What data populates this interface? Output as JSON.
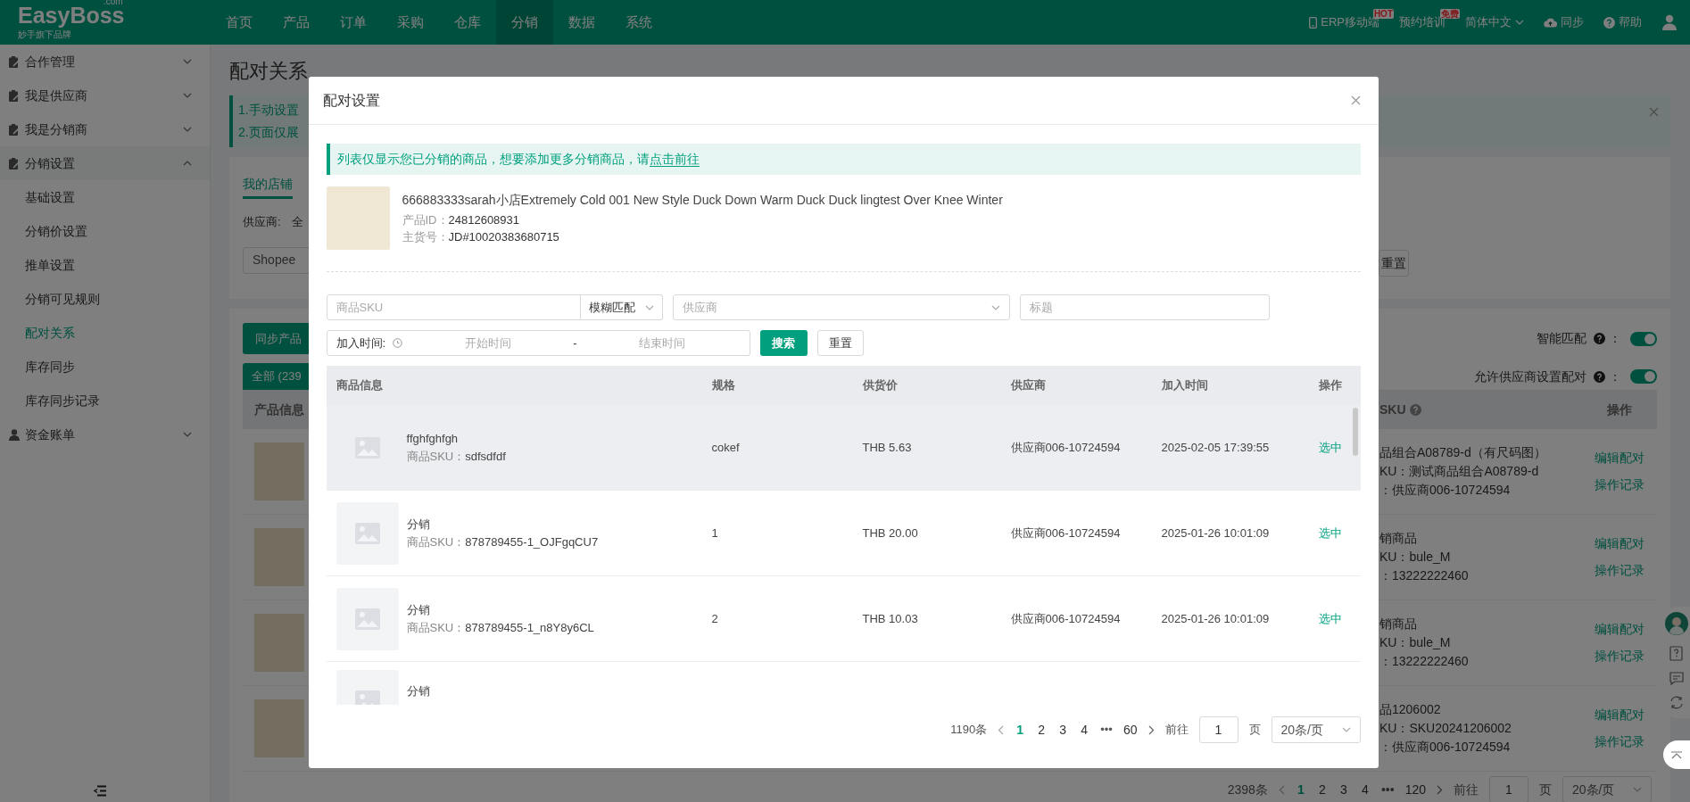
{
  "top_nav": {
    "logo": "EasyBoss",
    "logo_suffix": ".com",
    "logo_tagline": "妙手旗下品牌",
    "menu": [
      {
        "label": "首页",
        "selected": false
      },
      {
        "label": "产品",
        "selected": false
      },
      {
        "label": "订单",
        "selected": false
      },
      {
        "label": "采购",
        "selected": false
      },
      {
        "label": "仓库",
        "selected": false
      },
      {
        "label": "分销",
        "selected": true
      },
      {
        "label": "数据",
        "selected": false
      },
      {
        "label": "系统",
        "selected": false
      }
    ],
    "tools": [
      {
        "kind": "link",
        "label": "ERP移动端",
        "badge": "HOT"
      },
      {
        "kind": "link",
        "label": "预约培训",
        "badge": "免费"
      },
      {
        "kind": "dropdown",
        "label": "简体中文"
      },
      {
        "kind": "link",
        "label": "同步"
      },
      {
        "kind": "link",
        "label": "帮助"
      }
    ]
  },
  "sidebar": {
    "groups": [
      {
        "label": "合作管理",
        "expanded": false
      },
      {
        "label": "我是供应商",
        "expanded": false
      },
      {
        "label": "我是分销商",
        "expanded": false
      },
      {
        "label": "分销设置",
        "expanded": true,
        "children": [
          {
            "label": "基础设置",
            "selected": false
          },
          {
            "label": "分销价设置",
            "selected": false
          },
          {
            "label": "推单设置",
            "selected": false
          },
          {
            "label": "分销可见规则",
            "selected": false
          },
          {
            "label": "配对关系",
            "selected": true
          },
          {
            "label": "库存同步",
            "selected": false
          },
          {
            "label": "库存同步记录",
            "selected": false
          }
        ]
      },
      {
        "label": "资金账单",
        "expanded": false
      }
    ]
  },
  "page": {
    "title": "配对关系",
    "notice_lines": [
      "1.手动设置",
      "2.页面仅展"
    ],
    "store_tab": {
      "label": "我的店铺",
      "selected": true
    },
    "supplier_filter": {
      "label": "供应商:",
      "value": "全"
    },
    "platform_select": "Shopee",
    "reset_button": "重置",
    "sync_button": "同步产品",
    "switches": [
      {
        "label": "智能匹配",
        "suffix": "：",
        "on": true
      },
      {
        "label": "允许供应商设置配对",
        "suffix": "：",
        "on": true
      }
    ],
    "all_tab": {
      "label": "全部 (239",
      "selected": true
    },
    "columns": [
      "产品信息",
      "SKU",
      "操作"
    ],
    "rows": [
      {
        "lines": [
          "品组合A08789-d（有尺码图）",
          "KU：测试商品组合A08789-d",
          "：供应商006-10724594"
        ],
        "actions": [
          "编辑配对",
          "操作记录"
        ]
      },
      {
        "lines": [
          "销商品",
          "KU：bule_M",
          "：13222222460"
        ],
        "actions": [
          "编辑配对",
          "操作记录"
        ]
      },
      {
        "lines": [
          "销商品",
          "KU：bule_M",
          "：13222222460"
        ],
        "actions": [
          "编辑配对",
          "操作记录"
        ]
      },
      {
        "lines": [
          "品1206002",
          "KU：SKU20241206002",
          "：供应商006-10724594"
        ],
        "actions": [
          "编辑配对",
          "操作记录"
        ]
      }
    ],
    "pagination": {
      "total": "2398条",
      "pages": [
        {
          "label": "1",
          "selected": true
        },
        {
          "label": "2",
          "selected": false
        },
        {
          "label": "3",
          "selected": false
        },
        {
          "label": "4",
          "selected": false
        }
      ],
      "ellipsis": "•••",
      "last_page": "120",
      "goto_label": "前往",
      "goto_value": "1",
      "page_unit": "页",
      "page_size": "20条/页"
    }
  },
  "modal": {
    "title": "配对设置",
    "notice": "列表仅显示您已分销的商品，想要添加更多分销商品，请",
    "notice_link": "点击前往",
    "product": {
      "title": "666883333sarah小店Extremely Cold 001 New Style Duck Down Warm Duck Duck lingtest Over Knee Winter",
      "id_label": "产品ID：",
      "id": "24812608931",
      "code_label": "主货号：",
      "code": "JD#10020383680715"
    },
    "filters": {
      "sku_placeholder": "商品SKU",
      "match_mode": "模糊匹配",
      "supplier_placeholder": "供应商",
      "title_placeholder": "标题",
      "date_label": "加入时间:",
      "start_placeholder": "开始时间",
      "separator": "-",
      "end_placeholder": "结束时间",
      "search_button": "搜索",
      "reset_button": "重置"
    },
    "columns": [
      "商品信息",
      "规格",
      "供货价",
      "供应商",
      "加入时间",
      "操作"
    ],
    "rows": [
      {
        "highlighted": true,
        "name": "ffghfghfgh",
        "sku_label": "商品SKU：",
        "sku": "sdfsdfdf",
        "spec": "cokef",
        "price": "THB 5.63",
        "supplier": "供应商006-10724594",
        "time": "2025-02-05 17:39:55",
        "action": "选中"
      },
      {
        "highlighted": false,
        "name": "分销",
        "sku_label": "商品SKU：",
        "sku": "878789455-1_OJFgqCU7",
        "spec": "1",
        "price": "THB 20.00",
        "supplier": "供应商006-10724594",
        "time": "2025-01-26 10:01:09",
        "action": "选中"
      },
      {
        "highlighted": false,
        "name": "分销",
        "sku_label": "商品SKU：",
        "sku": "878789455-1_n8Y8y6CL",
        "spec": "2",
        "price": "THB 10.03",
        "supplier": "供应商006-10724594",
        "time": "2025-01-26 10:01:09",
        "action": "选中"
      },
      {
        "highlighted": false,
        "name": "分销"
      }
    ],
    "pagination": {
      "total": "1190条",
      "pages": [
        {
          "label": "1",
          "selected": true
        },
        {
          "label": "2",
          "selected": false
        },
        {
          "label": "3",
          "selected": false
        },
        {
          "label": "4",
          "selected": false
        }
      ],
      "ellipsis": "•••",
      "last_page": "60",
      "goto_label": "前往",
      "goto_value": "1",
      "page_unit": "页",
      "page_size": "20条/页"
    }
  }
}
